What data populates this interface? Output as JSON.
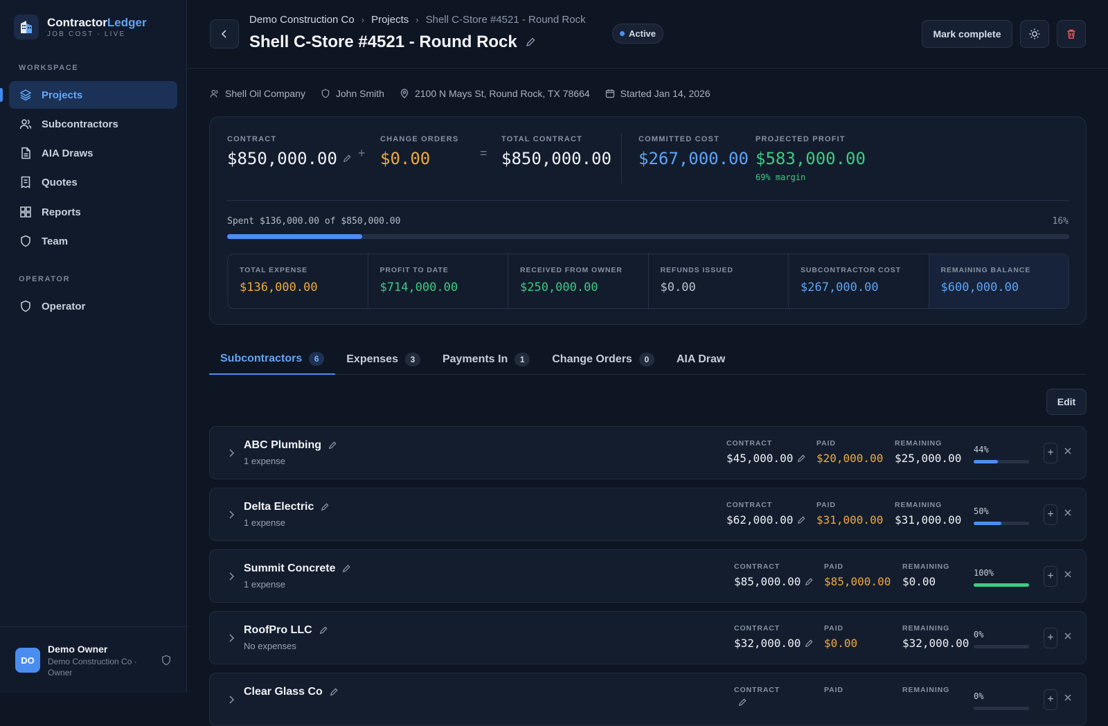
{
  "app": {
    "name_a": "Contractor",
    "name_b": "Ledger",
    "subtitle": "JOB COST · LIVE"
  },
  "sidebar": {
    "workspace_label": "WORKSPACE",
    "items": [
      {
        "label": "Projects",
        "icon": "layers-icon"
      },
      {
        "label": "Subcontractors",
        "icon": "users-icon"
      },
      {
        "label": "AIA Draws",
        "icon": "file-icon"
      },
      {
        "label": "Quotes",
        "icon": "receipt-icon"
      },
      {
        "label": "Reports",
        "icon": "grid-icon"
      },
      {
        "label": "Team",
        "icon": "shield-icon"
      }
    ],
    "operator_label": "OPERATOR",
    "operator_item": "Operator",
    "user": {
      "initials": "DO",
      "name": "Demo Owner",
      "org": "Demo Construction Co · Owner"
    }
  },
  "breadcrumb": {
    "company": "Demo Construction Co",
    "projects": "Projects",
    "current": "Shell C-Store #4521 - Round Rock"
  },
  "project": {
    "title": "Shell C-Store #4521 - Round Rock",
    "status": "Active",
    "client": "Shell Oil Company",
    "manager": "John Smith",
    "address": "2100 N Mays St, Round Rock, TX 78664",
    "started": "Started Jan 14, 2026"
  },
  "actions": {
    "mark_complete": "Mark complete"
  },
  "summary": {
    "contract_label": "CONTRACT",
    "contract": "$850,000.00",
    "co_label": "CHANGE ORDERS",
    "co": "$0.00",
    "total_label": "TOTAL CONTRACT",
    "total": "$850,000.00",
    "committed_label": "COMMITTED COST",
    "committed": "$267,000.00",
    "profit_label": "PROJECTED PROFIT",
    "profit": "$583,000.00",
    "margin": "69% margin",
    "op_plus": "+",
    "op_eq": "=",
    "spent_text": "Spent $136,000.00 of $850,000.00",
    "spent_pct": "16%",
    "spent_fraction": 0.16,
    "stats": [
      {
        "label": "TOTAL EXPENSE",
        "value": "$136,000.00",
        "color": "orange"
      },
      {
        "label": "PROFIT TO DATE",
        "value": "$714,000.00",
        "color": "green"
      },
      {
        "label": "RECEIVED FROM OWNER",
        "value": "$250,000.00",
        "color": "green"
      },
      {
        "label": "REFUNDS ISSUED",
        "value": "$0.00",
        "color": "gray"
      },
      {
        "label": "SUBCONTRACTOR COST",
        "value": "$267,000.00",
        "color": "blue"
      },
      {
        "label": "REMAINING BALANCE",
        "value": "$600,000.00",
        "color": "blue"
      }
    ]
  },
  "tabs": [
    {
      "label": "Subcontractors",
      "count": "6"
    },
    {
      "label": "Expenses",
      "count": "3"
    },
    {
      "label": "Payments In",
      "count": "1"
    },
    {
      "label": "Change Orders",
      "count": "0"
    },
    {
      "label": "AIA Draw",
      "count": ""
    }
  ],
  "edit_label": "Edit",
  "col_labels": {
    "contract": "CONTRACT",
    "paid": "PAID",
    "remaining": "REMAINING"
  },
  "subs": [
    {
      "name": "ABC Plumbing",
      "sub": "1 expense",
      "contract": "$45,000.00",
      "paid": "$20,000.00",
      "remaining": "$25,000.00",
      "pct": "44%",
      "fraction": 0.44,
      "bar": "#4a8ff0"
    },
    {
      "name": "Delta Electric",
      "sub": "1 expense",
      "contract": "$62,000.00",
      "paid": "$31,000.00",
      "remaining": "$31,000.00",
      "pct": "50%",
      "fraction": 0.5,
      "bar": "#4a8ff0"
    },
    {
      "name": "Summit Concrete",
      "sub": "1 expense",
      "contract": "$85,000.00",
      "paid": "$85,000.00",
      "remaining": "$0.00",
      "pct": "100%",
      "fraction": 1.0,
      "bar": "#3fcb82"
    },
    {
      "name": "RoofPro LLC",
      "sub": "No expenses",
      "contract": "$32,000.00",
      "paid": "$0.00",
      "remaining": "$32,000.00",
      "pct": "0%",
      "fraction": 0,
      "bar": "#4a8ff0"
    },
    {
      "name": "Clear Glass Co",
      "sub": "",
      "contract": "",
      "paid": "",
      "remaining": "",
      "pct": "0%",
      "fraction": 0,
      "bar": "#4a8ff0"
    }
  ]
}
